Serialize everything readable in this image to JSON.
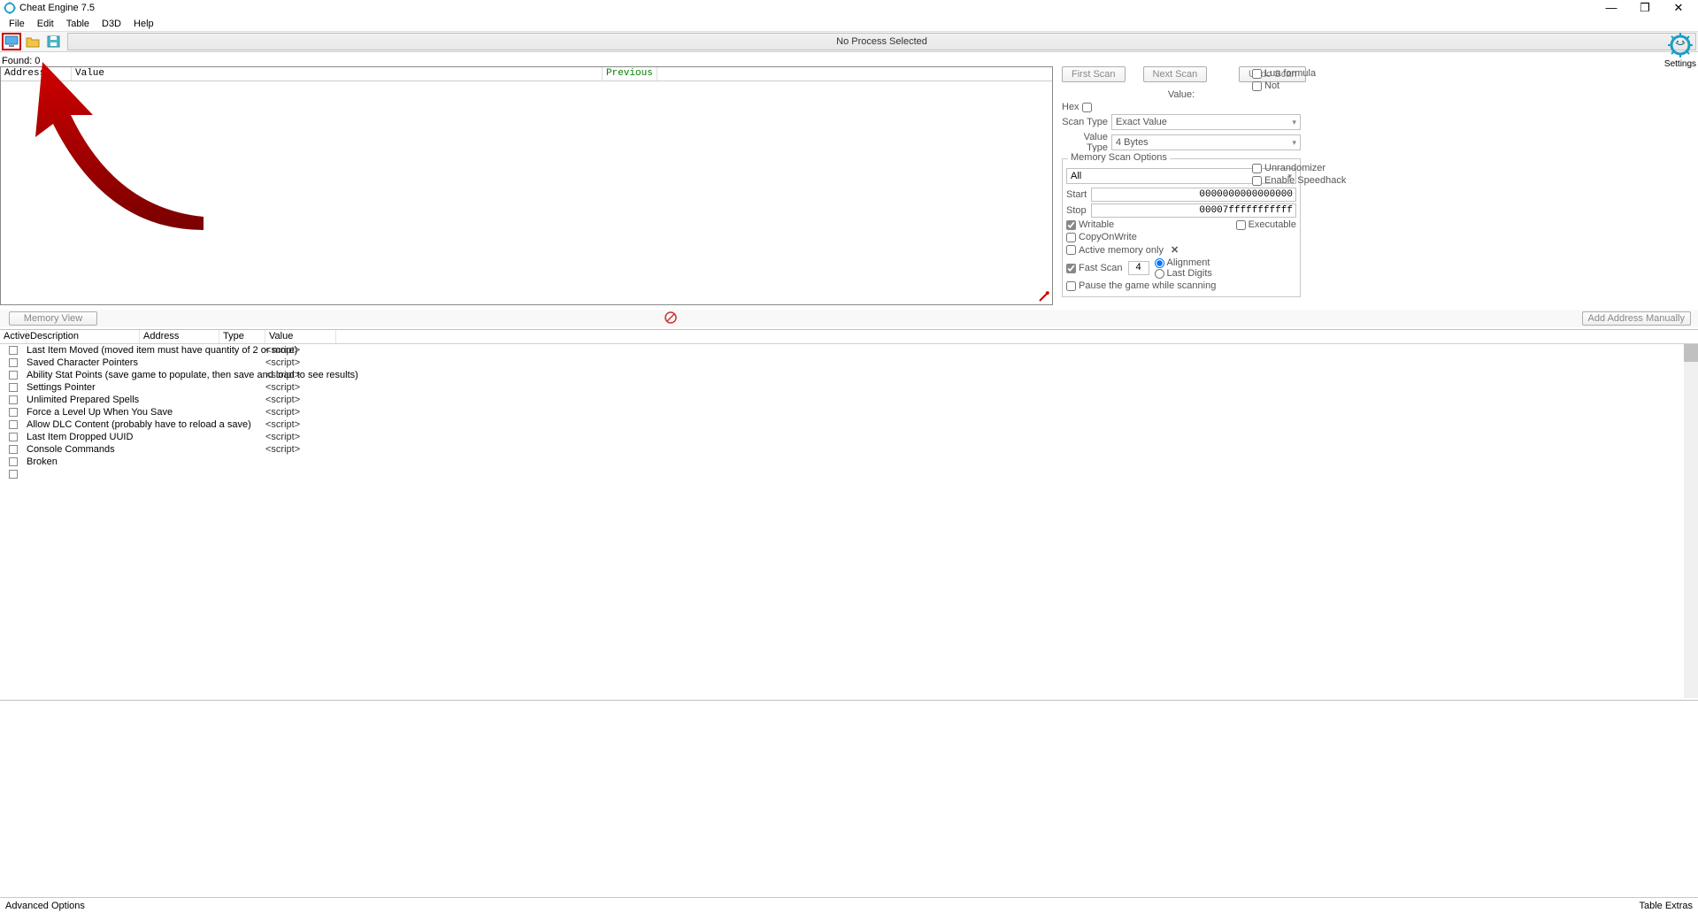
{
  "window": {
    "title": "Cheat Engine 7.5",
    "minimize": "—",
    "maximize": "❐",
    "close": "✕"
  },
  "menu": {
    "file": "File",
    "edit": "Edit",
    "table": "Table",
    "d3d": "D3D",
    "help": "Help"
  },
  "toolbar": {
    "process_bar": "No Process Selected",
    "settings_label": "Settings"
  },
  "found_label": "Found: 0",
  "results_header": {
    "address": "Address",
    "value": "Value",
    "previous": "Previous"
  },
  "scan": {
    "first_scan": "First Scan",
    "next_scan": "Next Scan",
    "undo_scan": "Undo Scan",
    "value_label": "Value:",
    "hex_label": "Hex",
    "scan_type_label": "Scan Type",
    "scan_type_value": "Exact Value",
    "value_type_label": "Value Type",
    "value_type_value": "4 Bytes",
    "lua_formula": "Lua formula",
    "not": "Not",
    "memory_scan_options": "Memory Scan Options",
    "region": "All",
    "start_label": "Start",
    "start_value": "0000000000000000",
    "stop_label": "Stop",
    "stop_value": "00007fffffffffff",
    "writable": "Writable",
    "executable": "Executable",
    "copyonwrite": "CopyOnWrite",
    "active_memory": "Active memory only",
    "fast_scan": "Fast Scan",
    "fast_scan_value": "4",
    "alignment": "Alignment",
    "last_digits": "Last Digits",
    "pause_game": "Pause the game while scanning",
    "unrandomizer": "Unrandomizer",
    "enable_speedhack": "Enable Speedhack"
  },
  "midbar": {
    "memory_view": "Memory View",
    "add_address_manually": "Add Address Manually"
  },
  "cheat_table": {
    "headers": {
      "active": "Active",
      "description": "Description",
      "address": "Address",
      "type": "Type",
      "value": "Value"
    },
    "rows": [
      {
        "description": "Last Item Moved (moved item must have quantity of 2 or more)",
        "value": "<script>"
      },
      {
        "description": "Saved Character Pointers",
        "value": "<script>"
      },
      {
        "description": "Ability Stat Points (save game to populate, then save and load to see results)",
        "value": "<script>"
      },
      {
        "description": "Settings Pointer",
        "value": "<script>"
      },
      {
        "description": "Unlimited Prepared Spells",
        "value": "<script>"
      },
      {
        "description": "Force a Level Up When You Save",
        "value": "<script>"
      },
      {
        "description": "Allow DLC Content (probably have to reload a save)",
        "value": "<script>"
      },
      {
        "description": "Last Item Dropped UUID",
        "value": "<script>"
      },
      {
        "description": "Console Commands",
        "value": "<script>"
      },
      {
        "description": "Broken",
        "value": ""
      }
    ]
  },
  "statusbar": {
    "advanced_options": "Advanced Options",
    "table_extras": "Table Extras"
  }
}
